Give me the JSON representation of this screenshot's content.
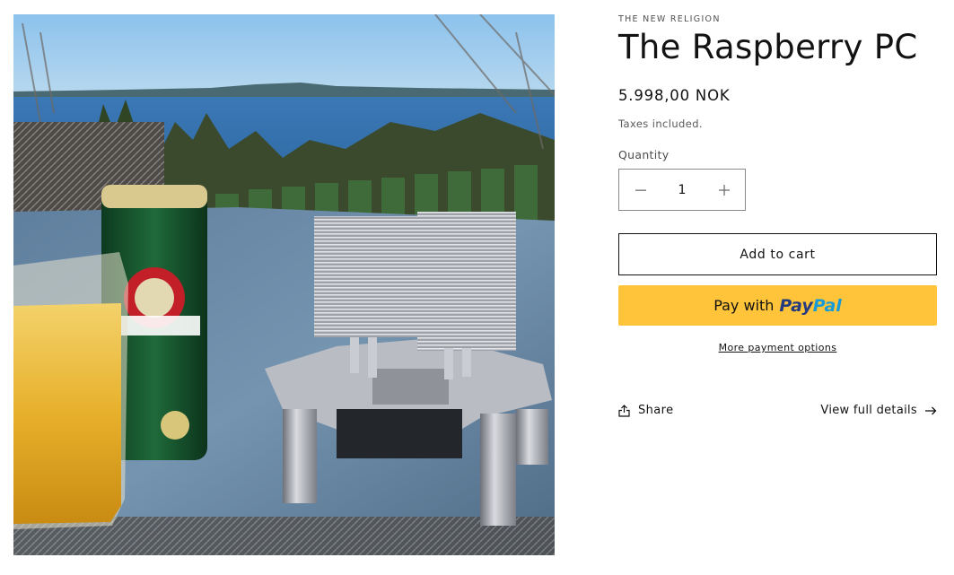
{
  "product": {
    "vendor": "THE NEW RELIGION",
    "title": "The Raspberry PC",
    "price": "5.998,00 NOK",
    "tax_note": "Taxes included.",
    "image_alt": "Raspberry Pi PC with two tower heatsinks on a glass table next to a Pilsner Urquell can and a glass of beer, overlooking a fjord"
  },
  "quantity": {
    "label": "Quantity",
    "value": "1",
    "decrease_icon": "minus-icon",
    "increase_icon": "plus-icon"
  },
  "buttons": {
    "add_to_cart": "Add to cart",
    "paypal_prefix": "Pay with",
    "paypal_brand_1": "Pay",
    "paypal_brand_2": "Pal",
    "more_payment": "More payment options"
  },
  "actions": {
    "share": "Share",
    "share_icon": "share-icon",
    "view_details": "View full details",
    "view_details_icon": "arrow-right-icon"
  },
  "colors": {
    "paypal_yellow": "#ffc439",
    "paypal_dark_blue": "#253b80",
    "paypal_light_blue": "#179bd7",
    "text": "#121212"
  }
}
